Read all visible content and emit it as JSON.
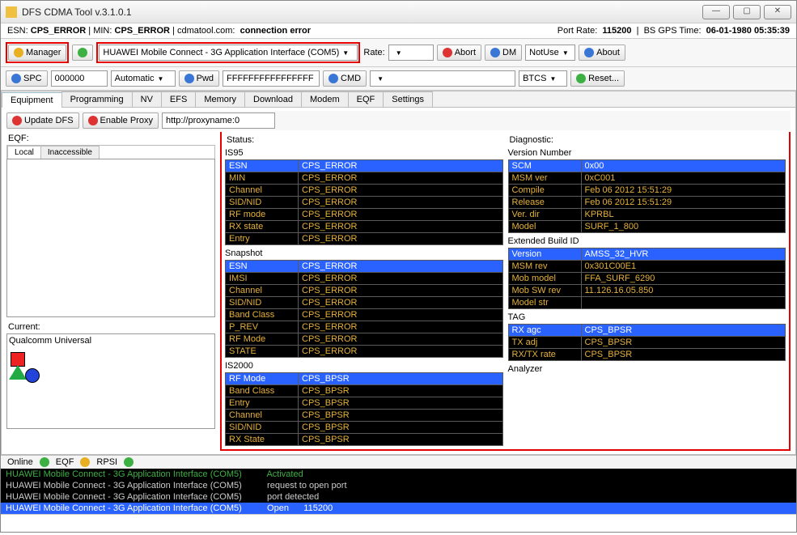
{
  "window": {
    "title": "DFS CDMA Tool v.3.1.0.1"
  },
  "infobar": {
    "esn_lbl": "ESN:",
    "esn_val": "CPS_ERROR",
    "min_lbl": "MIN:",
    "min_val": "CPS_ERROR",
    "site": "cdmatool.com:",
    "conn": "connection error",
    "portrate_lbl": "Port Rate:",
    "portrate_val": "115200",
    "gps_lbl": "BS GPS Time:",
    "gps_val": "06-01-1980 05:35:39"
  },
  "toolbar1": {
    "manager": "Manager",
    "device": "HUAWEI Mobile Connect - 3G Application Interface (COM5)",
    "rate_lbl": "Rate:",
    "rate_val": "",
    "abort": "Abort",
    "dm": "DM",
    "dm_val": "NotUse",
    "about": "About"
  },
  "toolbar2": {
    "spc": "SPC",
    "spc_val": "000000",
    "auto": "Automatic",
    "pwd": "Pwd",
    "pwd_val": "FFFFFFFFFFFFFFFF",
    "cmd": "CMD",
    "cmd_val": "",
    "btcs": "BTCS",
    "reset": "Reset..."
  },
  "tabs": {
    "list": [
      "Equipment",
      "Programming",
      "NV",
      "EFS",
      "Memory",
      "Download",
      "Modem",
      "EQF",
      "Settings"
    ],
    "update": "Update DFS",
    "proxy": "Enable Proxy",
    "proxy_val": "http://proxyname:0"
  },
  "eqf": {
    "label": "EQF:",
    "t1": "Local",
    "t2": "Inaccessible",
    "current_lbl": "Current:",
    "current_val": "Qualcomm Universal"
  },
  "status": {
    "label": "Status:",
    "is95_lbl": "IS95",
    "is95": [
      [
        "ESN",
        "CPS_ERROR",
        true
      ],
      [
        "MIN",
        "CPS_ERROR",
        false
      ],
      [
        "Channel",
        "CPS_ERROR",
        false
      ],
      [
        "SID/NID",
        "CPS_ERROR",
        false
      ],
      [
        "RF mode",
        "CPS_ERROR",
        false
      ],
      [
        "RX state",
        "CPS_ERROR",
        false
      ],
      [
        "Entry",
        "CPS_ERROR",
        false
      ]
    ],
    "snap_lbl": "Snapshot",
    "snap": [
      [
        "ESN",
        "CPS_ERROR",
        true
      ],
      [
        "IMSI",
        "CPS_ERROR",
        false
      ],
      [
        "Channel",
        "CPS_ERROR",
        false
      ],
      [
        "SID/NID",
        "CPS_ERROR",
        false
      ],
      [
        "Band Class",
        "CPS_ERROR",
        false
      ],
      [
        "P_REV",
        "CPS_ERROR",
        false
      ],
      [
        "RF Mode",
        "CPS_ERROR",
        false
      ],
      [
        "STATE",
        "CPS_ERROR",
        false
      ]
    ],
    "is2k_lbl": "IS2000",
    "is2k": [
      [
        "RF Mode",
        "CPS_BPSR",
        true
      ],
      [
        "Band Class",
        "CPS_BPSR",
        false
      ],
      [
        "Entry",
        "CPS_BPSR",
        false
      ],
      [
        "Channel",
        "CPS_BPSR",
        false
      ],
      [
        "SID/NID",
        "CPS_BPSR",
        false
      ],
      [
        "RX State",
        "CPS_BPSR",
        false
      ]
    ]
  },
  "diag": {
    "label": "Diagnostic:",
    "ver_lbl": "Version Number",
    "ver": [
      [
        "SCM",
        "0x00",
        true
      ],
      [
        "MSM ver",
        "0xC001",
        false
      ],
      [
        "Compile",
        "Feb 06 2012 15:51:29",
        false
      ],
      [
        "Release",
        "Feb 06 2012 15:51:29",
        false
      ],
      [
        "Ver. dir",
        "KPRBL",
        false
      ],
      [
        "Model",
        "SURF_1_800",
        false
      ]
    ],
    "ext_lbl": "Extended Build ID",
    "ext": [
      [
        "Version",
        "AMSS_32_HVR",
        true
      ],
      [
        "MSM rev",
        "0x301C00E1",
        false
      ],
      [
        "Mob model",
        "FFA_SURF_6290",
        false
      ],
      [
        "Mob SW rev",
        "11.126.16.05.850",
        false
      ],
      [
        "Model str",
        "",
        false
      ]
    ],
    "tag_lbl": "TAG",
    "tag": [
      [
        "RX agc",
        "CPS_BPSR",
        true
      ],
      [
        "TX adj",
        "CPS_BPSR",
        false
      ],
      [
        "RX/TX rate",
        "CPS_BPSR",
        false
      ]
    ],
    "ana_lbl": "Analyzer"
  },
  "statusbar": {
    "online": "Online",
    "eqf": "EQF",
    "rpsi": "RPSI"
  },
  "log": [
    {
      "cls": "g",
      "dev": "HUAWEI Mobile Connect - 3G Application Interface (COM5)",
      "msg": "Activated"
    },
    {
      "cls": "w",
      "dev": "HUAWEI Mobile Connect - 3G Application Interface (COM5)",
      "msg": "request to open port"
    },
    {
      "cls": "w",
      "dev": "HUAWEI Mobile Connect - 3G Application Interface (COM5)",
      "msg": "port detected"
    },
    {
      "cls": "b",
      "dev": "HUAWEI Mobile Connect - 3G Application Interface (COM5)",
      "msg": "Open",
      "extra": "115200"
    }
  ]
}
